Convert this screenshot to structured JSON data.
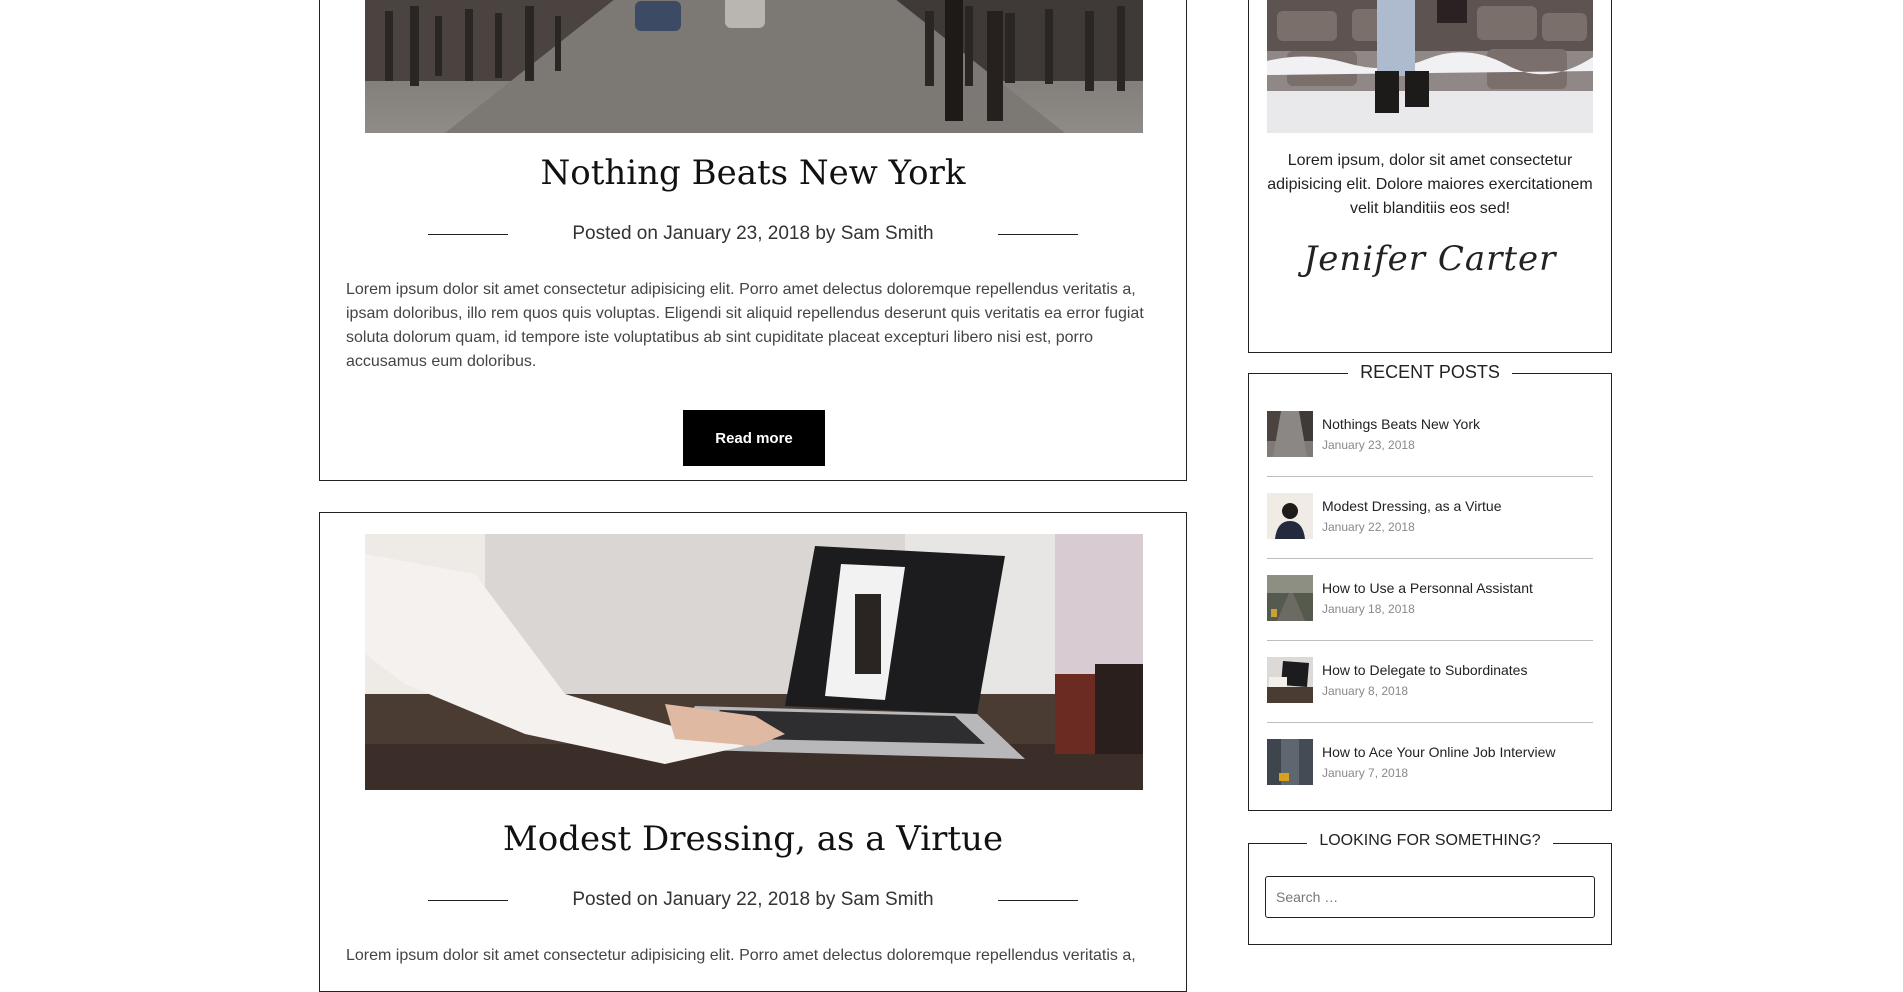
{
  "posts": [
    {
      "title": "Nothing Beats New York",
      "meta": {
        "prefix": "Posted on",
        "date": "January 23, 2018",
        "by": "by",
        "author": "Sam Smith"
      },
      "excerpt": "Lorem ipsum dolor sit amet consectetur adipisicing elit. Porro amet delectus doloremque repellendus veritatis a, ipsam doloribus, illo rem quos quis voluptas. Eligendi sit aliquid repellendus deserunt quis veritatis ea error fugiat soluta dolorum quam, id tempore iste voluptatibus ab sint cupiditate placeat excepturi libero nisi est, porro accusamus eum doloribus.",
      "read_more": "Read more"
    },
    {
      "title": "Modest Dressing, as a Virtue",
      "meta": {
        "prefix": "Posted on",
        "date": "January 22, 2018",
        "by": "by",
        "author": "Sam Smith"
      },
      "excerpt": "Lorem ipsum dolor sit amet consectetur adipisicing elit. Porro amet delectus doloremque repellendus veritatis a,"
    }
  ],
  "sidebar": {
    "about": {
      "text": "Lorem ipsum, dolor sit amet consectetur adipisicing elit. Dolore maiores exercitationem velit blanditiis eos sed!",
      "signature": "Jenifer Carter"
    },
    "recent_posts": {
      "title": "RECENT POSTS",
      "items": [
        {
          "title": "Nothings Beats New York",
          "date": "January 23, 2018"
        },
        {
          "title": "Modest Dressing, as a Virtue",
          "date": "January 22, 2018"
        },
        {
          "title": "How to Use a Personnal Assistant",
          "date": "January 18, 2018"
        },
        {
          "title": "How to Delegate to Subordinates",
          "date": "January 8, 2018"
        },
        {
          "title": "How to Ace Your Online Job Interview",
          "date": "January 7, 2018"
        }
      ]
    },
    "search": {
      "title": "LOOKING FOR SOMETHING?",
      "placeholder": "Search …"
    }
  },
  "colors": {
    "button_bg": "#000000",
    "border": "#222222",
    "date": "#888888"
  }
}
